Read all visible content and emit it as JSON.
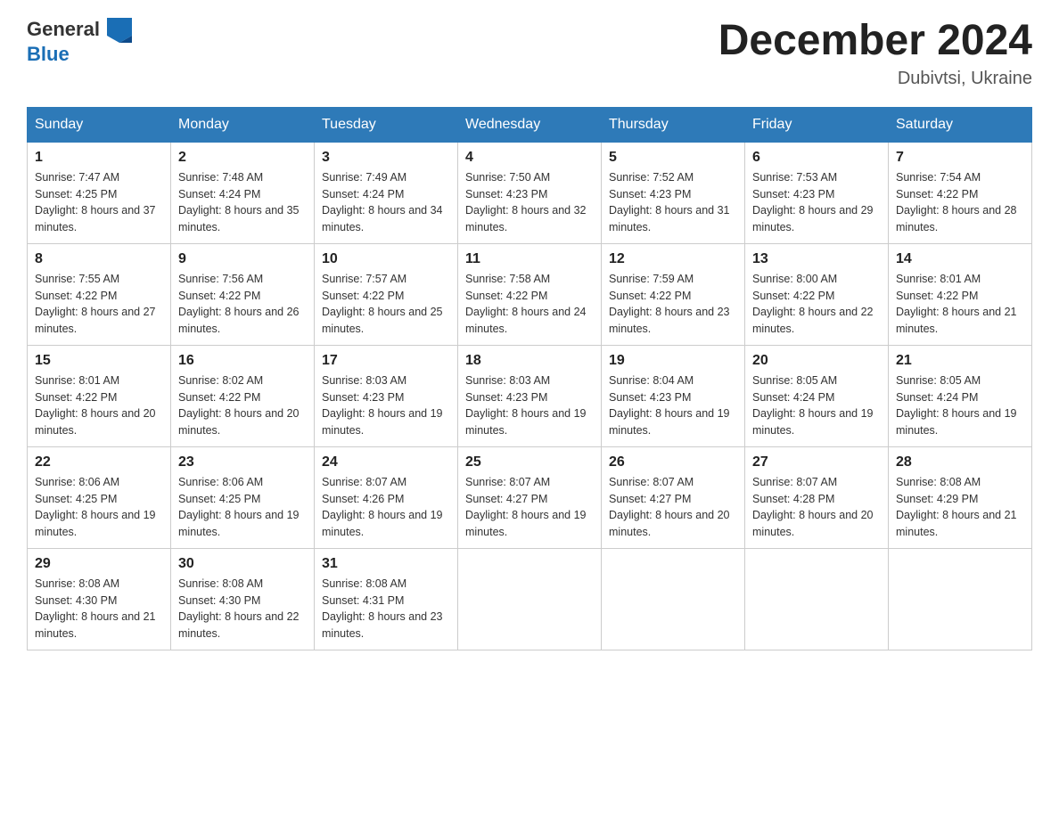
{
  "header": {
    "logo_general": "General",
    "logo_blue": "Blue",
    "month_title": "December 2024",
    "location": "Dubivtsi, Ukraine"
  },
  "days_of_week": [
    "Sunday",
    "Monday",
    "Tuesday",
    "Wednesday",
    "Thursday",
    "Friday",
    "Saturday"
  ],
  "weeks": [
    [
      {
        "day": "1",
        "sunrise": "7:47 AM",
        "sunset": "4:25 PM",
        "daylight": "8 hours and 37 minutes."
      },
      {
        "day": "2",
        "sunrise": "7:48 AM",
        "sunset": "4:24 PM",
        "daylight": "8 hours and 35 minutes."
      },
      {
        "day": "3",
        "sunrise": "7:49 AM",
        "sunset": "4:24 PM",
        "daylight": "8 hours and 34 minutes."
      },
      {
        "day": "4",
        "sunrise": "7:50 AM",
        "sunset": "4:23 PM",
        "daylight": "8 hours and 32 minutes."
      },
      {
        "day": "5",
        "sunrise": "7:52 AM",
        "sunset": "4:23 PM",
        "daylight": "8 hours and 31 minutes."
      },
      {
        "day": "6",
        "sunrise": "7:53 AM",
        "sunset": "4:23 PM",
        "daylight": "8 hours and 29 minutes."
      },
      {
        "day": "7",
        "sunrise": "7:54 AM",
        "sunset": "4:22 PM",
        "daylight": "8 hours and 28 minutes."
      }
    ],
    [
      {
        "day": "8",
        "sunrise": "7:55 AM",
        "sunset": "4:22 PM",
        "daylight": "8 hours and 27 minutes."
      },
      {
        "day": "9",
        "sunrise": "7:56 AM",
        "sunset": "4:22 PM",
        "daylight": "8 hours and 26 minutes."
      },
      {
        "day": "10",
        "sunrise": "7:57 AM",
        "sunset": "4:22 PM",
        "daylight": "8 hours and 25 minutes."
      },
      {
        "day": "11",
        "sunrise": "7:58 AM",
        "sunset": "4:22 PM",
        "daylight": "8 hours and 24 minutes."
      },
      {
        "day": "12",
        "sunrise": "7:59 AM",
        "sunset": "4:22 PM",
        "daylight": "8 hours and 23 minutes."
      },
      {
        "day": "13",
        "sunrise": "8:00 AM",
        "sunset": "4:22 PM",
        "daylight": "8 hours and 22 minutes."
      },
      {
        "day": "14",
        "sunrise": "8:01 AM",
        "sunset": "4:22 PM",
        "daylight": "8 hours and 21 minutes."
      }
    ],
    [
      {
        "day": "15",
        "sunrise": "8:01 AM",
        "sunset": "4:22 PM",
        "daylight": "8 hours and 20 minutes."
      },
      {
        "day": "16",
        "sunrise": "8:02 AM",
        "sunset": "4:22 PM",
        "daylight": "8 hours and 20 minutes."
      },
      {
        "day": "17",
        "sunrise": "8:03 AM",
        "sunset": "4:23 PM",
        "daylight": "8 hours and 19 minutes."
      },
      {
        "day": "18",
        "sunrise": "8:03 AM",
        "sunset": "4:23 PM",
        "daylight": "8 hours and 19 minutes."
      },
      {
        "day": "19",
        "sunrise": "8:04 AM",
        "sunset": "4:23 PM",
        "daylight": "8 hours and 19 minutes."
      },
      {
        "day": "20",
        "sunrise": "8:05 AM",
        "sunset": "4:24 PM",
        "daylight": "8 hours and 19 minutes."
      },
      {
        "day": "21",
        "sunrise": "8:05 AM",
        "sunset": "4:24 PM",
        "daylight": "8 hours and 19 minutes."
      }
    ],
    [
      {
        "day": "22",
        "sunrise": "8:06 AM",
        "sunset": "4:25 PM",
        "daylight": "8 hours and 19 minutes."
      },
      {
        "day": "23",
        "sunrise": "8:06 AM",
        "sunset": "4:25 PM",
        "daylight": "8 hours and 19 minutes."
      },
      {
        "day": "24",
        "sunrise": "8:07 AM",
        "sunset": "4:26 PM",
        "daylight": "8 hours and 19 minutes."
      },
      {
        "day": "25",
        "sunrise": "8:07 AM",
        "sunset": "4:27 PM",
        "daylight": "8 hours and 19 minutes."
      },
      {
        "day": "26",
        "sunrise": "8:07 AM",
        "sunset": "4:27 PM",
        "daylight": "8 hours and 20 minutes."
      },
      {
        "day": "27",
        "sunrise": "8:07 AM",
        "sunset": "4:28 PM",
        "daylight": "8 hours and 20 minutes."
      },
      {
        "day": "28",
        "sunrise": "8:08 AM",
        "sunset": "4:29 PM",
        "daylight": "8 hours and 21 minutes."
      }
    ],
    [
      {
        "day": "29",
        "sunrise": "8:08 AM",
        "sunset": "4:30 PM",
        "daylight": "8 hours and 21 minutes."
      },
      {
        "day": "30",
        "sunrise": "8:08 AM",
        "sunset": "4:30 PM",
        "daylight": "8 hours and 22 minutes."
      },
      {
        "day": "31",
        "sunrise": "8:08 AM",
        "sunset": "4:31 PM",
        "daylight": "8 hours and 23 minutes."
      },
      null,
      null,
      null,
      null
    ]
  ]
}
